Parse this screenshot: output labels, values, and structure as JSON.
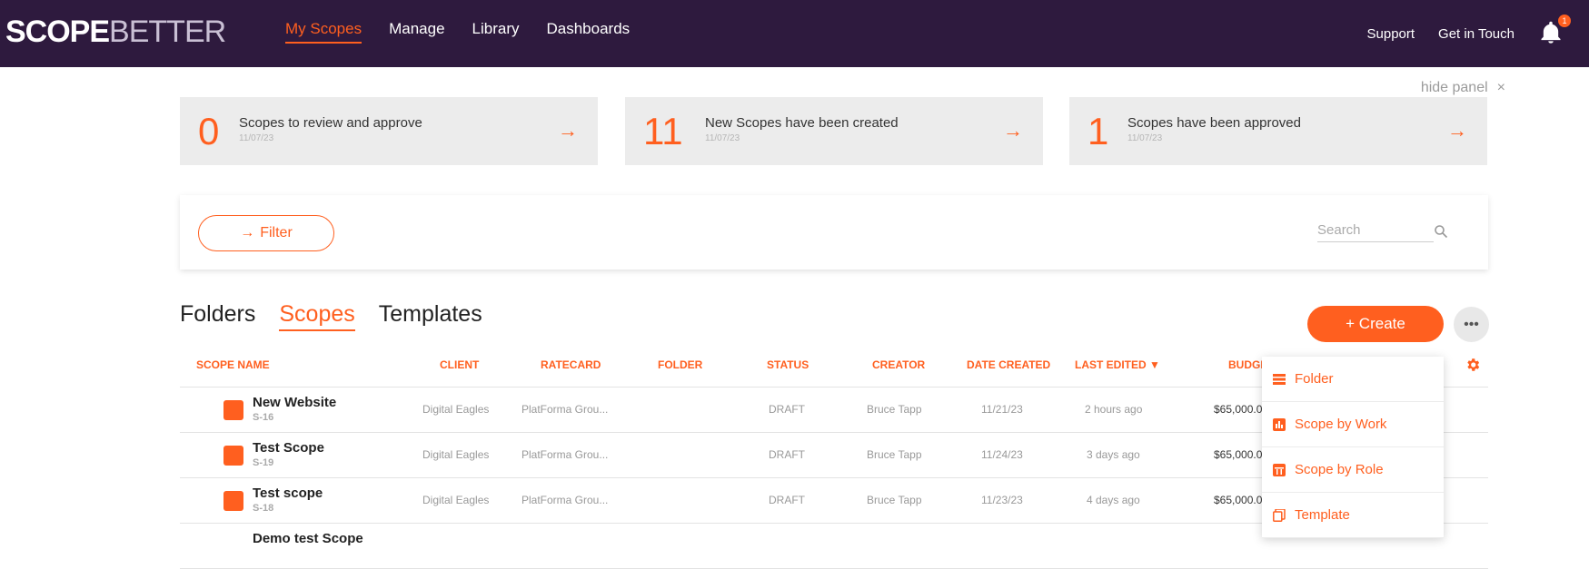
{
  "app": {
    "logo_scope": "SCOPE",
    "logo_better": "BETTER"
  },
  "nav": {
    "items": [
      "My Scopes",
      "Manage",
      "Library",
      "Dashboards"
    ],
    "support": "Support",
    "get_in_touch": "Get in Touch",
    "notification_count": "1"
  },
  "panel": {
    "hide_label": "hide panel",
    "close_glyph": "×"
  },
  "summary": [
    {
      "count": "0",
      "label": "Scopes to review and approve",
      "date": "11/07/23"
    },
    {
      "count": "11",
      "label": "New Scopes have been created",
      "date": "11/07/23"
    },
    {
      "count": "1",
      "label": "Scopes have been approved",
      "date": "11/07/23"
    }
  ],
  "filter": {
    "button_label": "Filter",
    "search_placeholder": "Search"
  },
  "tabs": [
    "Folders",
    "Scopes",
    "Templates"
  ],
  "actions": {
    "create_label": "+ Create",
    "more_glyph": "•••"
  },
  "table": {
    "columns": [
      "Scope Name",
      "Client",
      "Ratecard",
      "Folder",
      "Status",
      "Creator",
      "Date Created",
      "Last Edited ▼",
      "Budge"
    ],
    "rows": [
      {
        "name": "New Website",
        "id": "S-16",
        "client": "Digital Eagles",
        "ratecard": "PlatForma Grou...",
        "folder": "",
        "status": "DRAFT",
        "creator": "Bruce Tapp",
        "date_created": "11/21/23",
        "last_edited": "2 hours ago",
        "budget": "$65,000.0"
      },
      {
        "name": "Test Scope",
        "id": "S-19",
        "client": "Digital Eagles",
        "ratecard": "PlatForma Grou...",
        "folder": "",
        "status": "DRAFT",
        "creator": "Bruce Tapp",
        "date_created": "11/24/23",
        "last_edited": "3 days ago",
        "budget": "$65,000.0"
      },
      {
        "name": "Test scope",
        "id": "S-18",
        "client": "Digital Eagles",
        "ratecard": "PlatForma Grou...",
        "folder": "",
        "status": "DRAFT",
        "creator": "Bruce Tapp",
        "date_created": "11/23/23",
        "last_edited": "4 days ago",
        "budget": "$65,000.0"
      },
      {
        "name": "Demo test Scope",
        "id": "",
        "client": "",
        "ratecard": "",
        "folder": "",
        "status": "",
        "creator": "",
        "date_created": "",
        "last_edited": "",
        "budget": ""
      }
    ]
  },
  "create_menu": {
    "items": [
      "Folder",
      "Scope by Work",
      "Scope by Role",
      "Template"
    ]
  },
  "colors": {
    "accent": "#ff5f1f",
    "topbar": "#2e1a3e"
  }
}
